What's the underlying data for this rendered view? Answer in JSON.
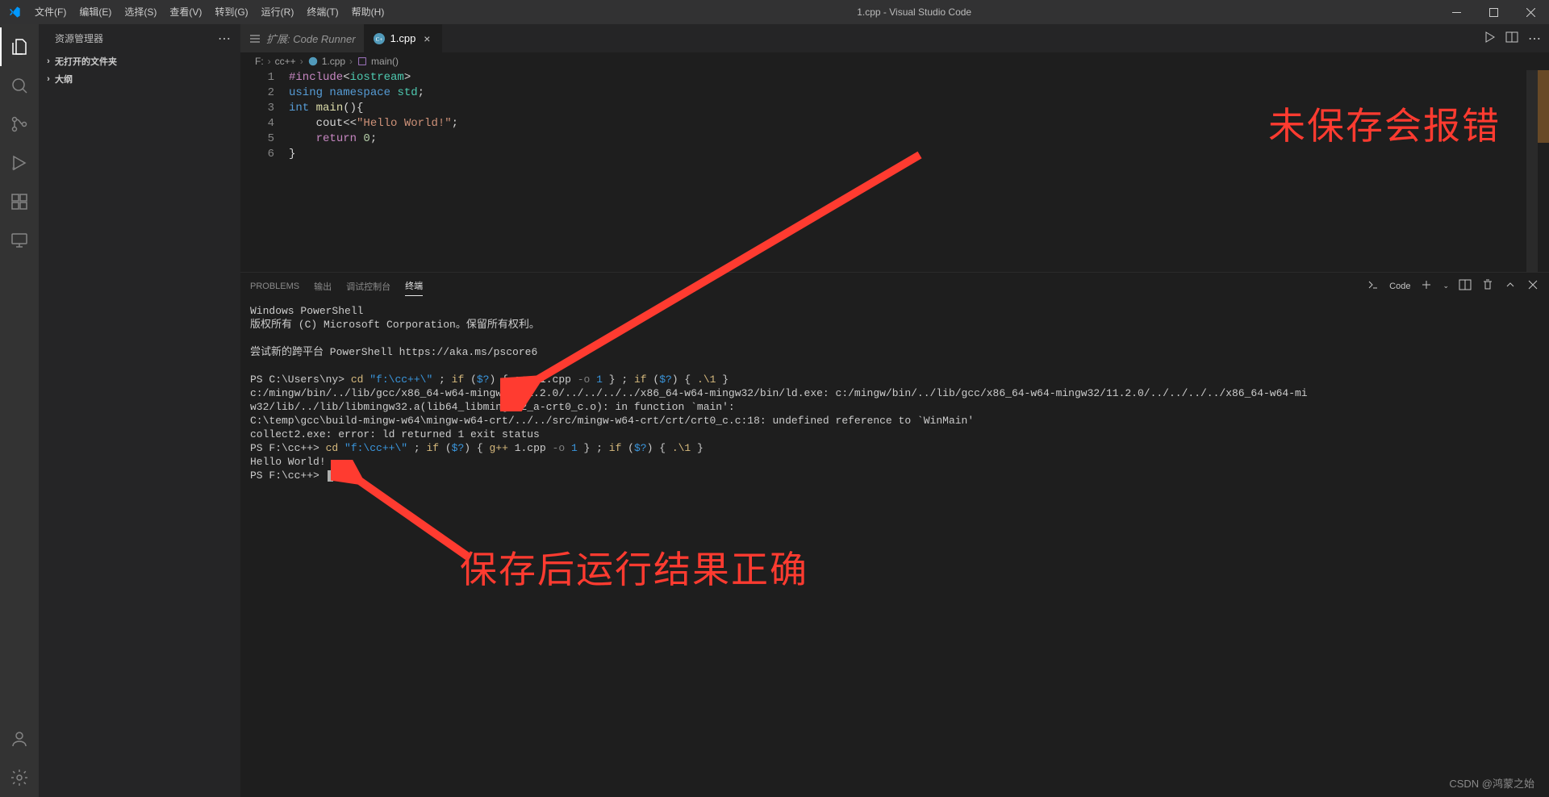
{
  "window": {
    "title": "1.cpp - Visual Studio Code"
  },
  "menu": {
    "items": [
      "文件(F)",
      "编辑(E)",
      "选择(S)",
      "查看(V)",
      "转到(G)",
      "运行(R)",
      "终端(T)",
      "帮助(H)"
    ]
  },
  "sidebar": {
    "title": "资源管理器",
    "sections": [
      "无打开的文件夹",
      "大纲"
    ]
  },
  "tabs": {
    "items": [
      {
        "label": "扩展: Code Runner",
        "active": false,
        "icon": "extension"
      },
      {
        "label": "1.cpp",
        "active": true,
        "icon": "cpp"
      }
    ]
  },
  "breadcrumbs": {
    "parts": [
      "F:",
      "cc++",
      "1.cpp",
      "main()"
    ]
  },
  "editor": {
    "lines": [
      {
        "n": 1,
        "tokens": [
          [
            "k-pp",
            "#include"
          ],
          [
            "k-op",
            "<"
          ],
          [
            "k-ns",
            "iostream"
          ],
          [
            "k-op",
            ">"
          ]
        ]
      },
      {
        "n": 2,
        "tokens": [
          [
            "k-kw",
            "using "
          ],
          [
            "k-kw",
            "namespace "
          ],
          [
            "k-ns",
            "std"
          ],
          [
            "k-op",
            ";"
          ]
        ]
      },
      {
        "n": 3,
        "tokens": [
          [
            "k-kw",
            "int "
          ],
          [
            "k-fn",
            "main"
          ],
          [
            "k-op",
            "(){"
          ]
        ]
      },
      {
        "n": 4,
        "tokens": [
          [
            "k-op",
            "    cout"
          ],
          [
            "k-op",
            "<<"
          ],
          [
            "k-str",
            "\"Hello World!\""
          ],
          [
            "k-op",
            ";"
          ]
        ]
      },
      {
        "n": 5,
        "tokens": [
          [
            "k-op",
            "    "
          ],
          [
            "k-ctrl",
            "return "
          ],
          [
            "k-num",
            "0"
          ],
          [
            "k-op",
            ";"
          ]
        ]
      },
      {
        "n": 6,
        "tokens": [
          [
            "k-op",
            "}"
          ]
        ]
      }
    ]
  },
  "panel": {
    "tabs": [
      "PROBLEMS",
      "输出",
      "调试控制台",
      "终端"
    ],
    "active_tab": "终端",
    "shell_label": "Code"
  },
  "terminal": {
    "lines": [
      [
        [
          "t-w",
          "Windows PowerShell"
        ]
      ],
      [
        [
          "t-w",
          "版权所有 (C) Microsoft Corporation。保留所有权利。"
        ]
      ],
      [],
      [
        [
          "t-w",
          "尝试新的跨平台 PowerShell https://aka.ms/pscore6"
        ]
      ],
      [],
      [
        [
          "t-w",
          "PS C:\\Users\\ny> "
        ],
        [
          "t-y",
          "cd "
        ],
        [
          "t-c",
          "\"f:\\cc++\\\""
        ],
        [
          "t-w",
          " ; "
        ],
        [
          "t-y",
          "if"
        ],
        [
          "t-w",
          " ("
        ],
        [
          "t-c",
          "$?"
        ],
        [
          "t-w",
          ") { "
        ],
        [
          "t-y",
          "g++"
        ],
        [
          "t-w",
          " 1.cpp "
        ],
        [
          "t-g",
          "-o"
        ],
        [
          "t-w",
          " "
        ],
        [
          "t-c",
          "1"
        ],
        [
          "t-w",
          " } ; "
        ],
        [
          "t-y",
          "if"
        ],
        [
          "t-w",
          " ("
        ],
        [
          "t-c",
          "$?"
        ],
        [
          "t-w",
          ") { "
        ],
        [
          "t-y",
          ".\\1"
        ],
        [
          "t-w",
          " }"
        ]
      ],
      [
        [
          "t-w",
          "c:/mingw/bin/../lib/gcc/x86_64-w64-mingw32/11.2.0/../../../../x86_64-w64-mingw32/bin/ld.exe: c:/mingw/bin/../lib/gcc/x86_64-w64-mingw32/11.2.0/../../../../x86_64-w64-mi"
        ]
      ],
      [
        [
          "t-w",
          "w32/lib/../lib/libmingw32.a(lib64_libmingw32_a-crt0_c.o): in function `main':"
        ]
      ],
      [
        [
          "t-w",
          "C:\\temp\\gcc\\build-mingw-w64\\mingw-w64-crt/../../src/mingw-w64-crt/crt/crt0_c.c:18: undefined reference to `WinMain'"
        ]
      ],
      [
        [
          "t-w",
          "collect2.exe: error: ld returned 1 exit status"
        ]
      ],
      [
        [
          "t-w",
          "PS F:\\cc++> "
        ],
        [
          "t-y",
          "cd "
        ],
        [
          "t-c",
          "\"f:\\cc++\\\""
        ],
        [
          "t-w",
          " ; "
        ],
        [
          "t-y",
          "if"
        ],
        [
          "t-w",
          " ("
        ],
        [
          "t-c",
          "$?"
        ],
        [
          "t-w",
          ") { "
        ],
        [
          "t-y",
          "g++"
        ],
        [
          "t-w",
          " 1.cpp "
        ],
        [
          "t-g",
          "-o"
        ],
        [
          "t-w",
          " "
        ],
        [
          "t-c",
          "1"
        ],
        [
          "t-w",
          " } ; "
        ],
        [
          "t-y",
          "if"
        ],
        [
          "t-w",
          " ("
        ],
        [
          "t-c",
          "$?"
        ],
        [
          "t-w",
          ") { "
        ],
        [
          "t-y",
          ".\\1"
        ],
        [
          "t-w",
          " }"
        ]
      ],
      [
        [
          "t-w",
          "Hello World!"
        ]
      ],
      [
        [
          "t-w",
          "PS F:\\cc++> "
        ]
      ]
    ]
  },
  "annotations": {
    "top": "未保存会报错",
    "bottom": "保存后运行结果正确"
  },
  "watermark": "CSDN @鸿蒙之始"
}
